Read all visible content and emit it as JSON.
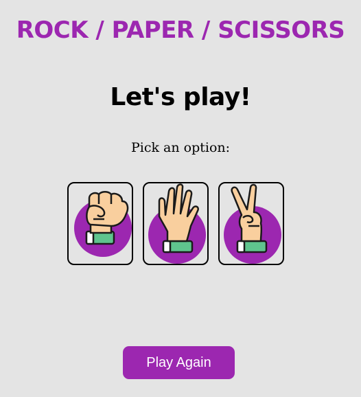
{
  "title": "ROCK / PAPER / SCISSORS",
  "heading": "Let's play!",
  "prompt": "Pick an option:",
  "options": [
    {
      "icon": "rock-hand-icon"
    },
    {
      "icon": "paper-hand-icon"
    },
    {
      "icon": "scissors-hand-icon"
    }
  ],
  "play_again_label": "Play Again",
  "colors": {
    "accent": "#9c27b0",
    "background": "#e4e4e4",
    "skin": "#f9cf9e",
    "cuff": "#5fc48e"
  }
}
